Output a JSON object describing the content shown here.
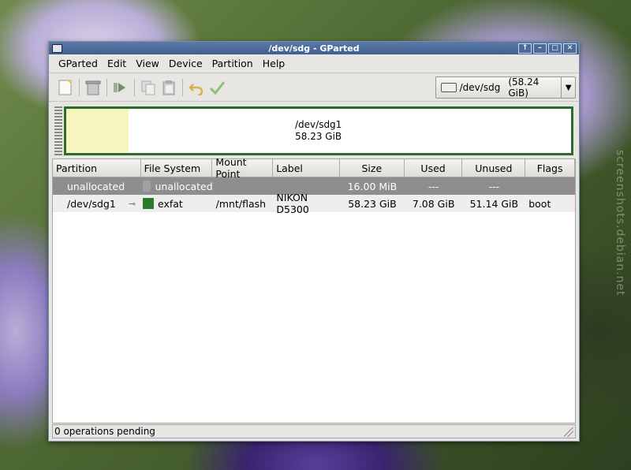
{
  "wallpaper_watermark": "screenshots.debian.net",
  "window": {
    "title": "/dev/sdg - GParted"
  },
  "titlebar_controls": [
    "↑",
    "–",
    "□",
    "✕"
  ],
  "menubar": {
    "items": [
      "GParted",
      "Edit",
      "View",
      "Device",
      "Partition",
      "Help"
    ]
  },
  "toolbar": {
    "buttons": [
      "new-icon",
      "delete-icon",
      "resize-move-icon",
      "copy-icon",
      "paste-icon",
      "undo-icon",
      "apply-icon"
    ],
    "device": {
      "name": "/dev/sdg",
      "size": "(58.24 GiB)"
    }
  },
  "visual": {
    "partition_name": "/dev/sdg1",
    "partition_size": "58.23 GiB",
    "colors": {
      "border": "#2c6b2c",
      "unallocated": "#f8f6c0"
    }
  },
  "table": {
    "columns": [
      "Partition",
      "File System",
      "Mount Point",
      "Label",
      "Size",
      "Used",
      "Unused",
      "Flags"
    ],
    "rows": [
      {
        "partition": "unallocated",
        "filesystem": "unallocated",
        "mount": "",
        "label": "",
        "size": "16.00 MiB",
        "used": "---",
        "unused": "---",
        "flags": "",
        "fs_color": "#a0a0a0"
      },
      {
        "partition": "/dev/sdg1",
        "filesystem": "exfat",
        "mount": "/mnt/flash",
        "label": "NIKON D5300",
        "size": "58.23 GiB",
        "used": "7.08 GiB",
        "unused": "51.14 GiB",
        "flags": "boot",
        "fs_color": "#2a7a2a"
      }
    ]
  },
  "status": {
    "text": "0 operations pending"
  }
}
